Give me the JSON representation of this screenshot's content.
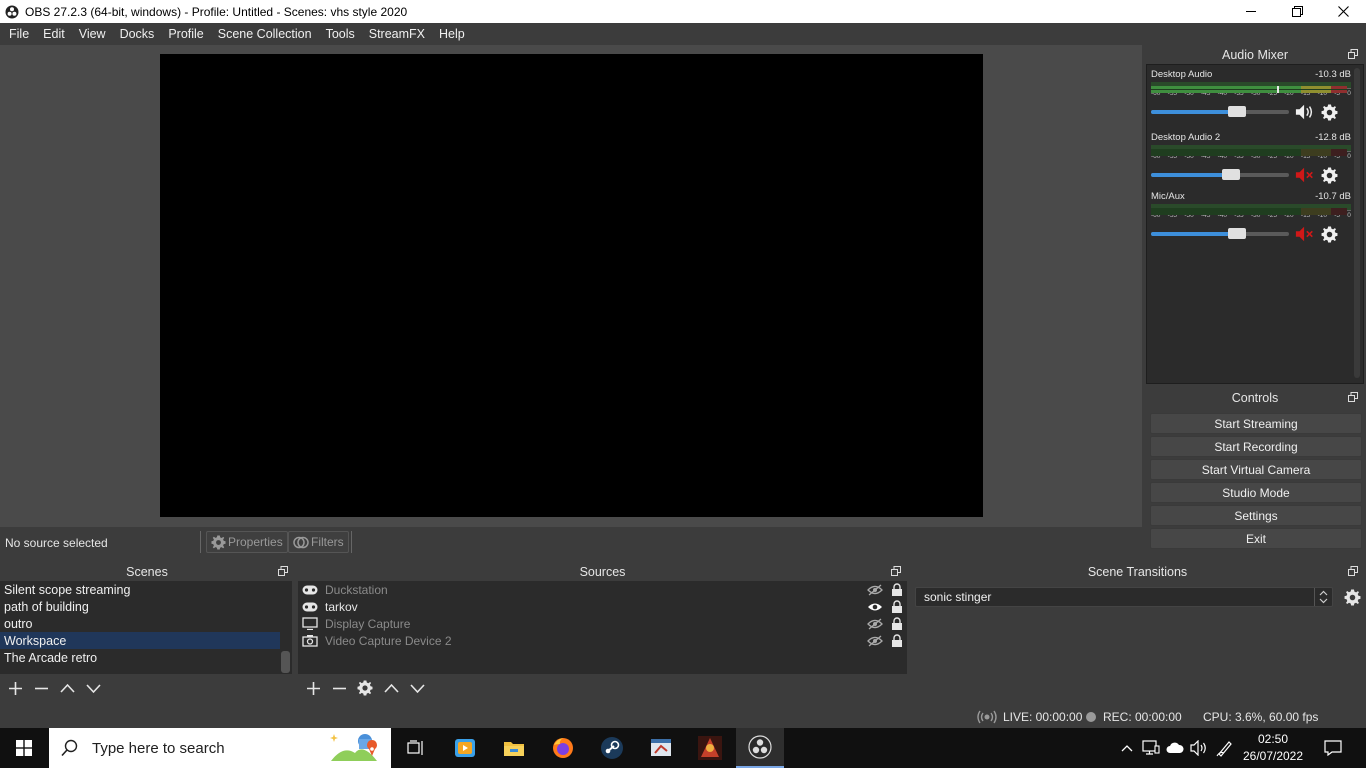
{
  "window": {
    "title": "OBS 27.2.3 (64-bit, windows) - Profile: Untitled - Scenes: vhs style 2020"
  },
  "menu": [
    "File",
    "Edit",
    "View",
    "Docks",
    "Profile",
    "Scene Collection",
    "Tools",
    "StreamFX",
    "Help"
  ],
  "audio_mixer": {
    "title": "Audio Mixer",
    "channels": [
      {
        "name": "Desktop Audio",
        "db": "-10.3 dB",
        "level": 0.62,
        "muted": false
      },
      {
        "name": "Desktop Audio 2",
        "db": "-12.8 dB",
        "level": 0.58,
        "muted": true
      },
      {
        "name": "Mic/Aux",
        "db": "-10.7 dB",
        "level": 0.62,
        "muted": true
      }
    ],
    "scale_ticks": [
      "-60",
      "-55",
      "-50",
      "-45",
      "-40",
      "-35",
      "-30",
      "-25",
      "-20",
      "-15",
      "-10",
      "-5",
      "0"
    ]
  },
  "controls": {
    "title": "Controls",
    "buttons": [
      "Start Streaming",
      "Start Recording",
      "Start Virtual Camera",
      "Studio Mode",
      "Settings",
      "Exit"
    ]
  },
  "source_toolbar": {
    "status": "No source selected",
    "properties": "Properties",
    "filters": "Filters"
  },
  "scenes": {
    "title": "Scenes",
    "items": [
      "Silent scope streaming",
      "path of building",
      "outro",
      "Workspace",
      "The Arcade retro"
    ],
    "selected": "Workspace"
  },
  "sources": {
    "title": "Sources",
    "items": [
      {
        "name": "Duckstation",
        "type": "game",
        "visible": false
      },
      {
        "name": "tarkov",
        "type": "game",
        "visible": true
      },
      {
        "name": "Display Capture",
        "type": "display",
        "visible": false
      },
      {
        "name": "Video Capture Device 2",
        "type": "camera",
        "visible": false
      }
    ]
  },
  "transitions": {
    "title": "Scene Transitions",
    "selected": "sonic stinger"
  },
  "status": {
    "live": "LIVE: 00:00:00",
    "rec": "REC: 00:00:00",
    "cpu": "CPU: 3.6%, 60.00 fps"
  },
  "taskbar": {
    "search_placeholder": "Type here to search",
    "time": "02:50",
    "date": "26/07/2022"
  },
  "colors": {
    "accent": "#3d8fdb",
    "selection": "#20375a",
    "muted_red": "#d01818",
    "meter_green": "#4caf50"
  }
}
